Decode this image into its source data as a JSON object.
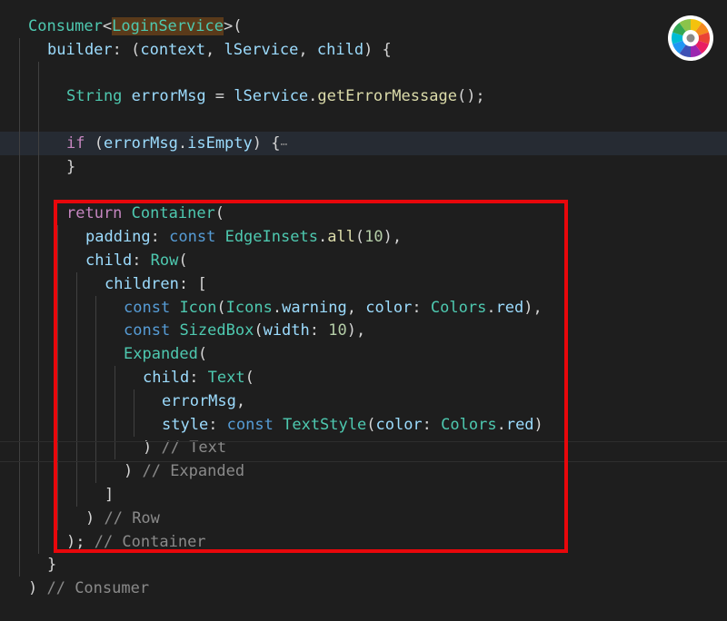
{
  "editor": {
    "language": "Dart",
    "highlight_color": "#e8070b",
    "lines": [
      {
        "indent": 0,
        "tokens": [
          {
            "t": "Consumer",
            "c": "type"
          },
          {
            "t": "<",
            "c": "punc"
          },
          {
            "t": "LoginService",
            "c": "type",
            "hl": true
          },
          {
            "t": ">(",
            "c": "punc"
          }
        ]
      },
      {
        "indent": 1,
        "tokens": [
          {
            "t": "builder",
            "c": "var"
          },
          {
            "t": ": (",
            "c": "punc"
          },
          {
            "t": "context",
            "c": "var"
          },
          {
            "t": ", ",
            "c": "punc"
          },
          {
            "t": "lService",
            "c": "var"
          },
          {
            "t": ", ",
            "c": "punc"
          },
          {
            "t": "child",
            "c": "var"
          },
          {
            "t": ") {",
            "c": "punc"
          }
        ]
      },
      {
        "indent": 2,
        "tokens": []
      },
      {
        "indent": 2,
        "tokens": [
          {
            "t": "String",
            "c": "type"
          },
          {
            "t": " ",
            "c": "punc"
          },
          {
            "t": "errorMsg",
            "c": "var"
          },
          {
            "t": " = ",
            "c": "punc"
          },
          {
            "t": "lService",
            "c": "var"
          },
          {
            "t": ".",
            "c": "punc"
          },
          {
            "t": "getErrorMessage",
            "c": "fn"
          },
          {
            "t": "();",
            "c": "punc"
          }
        ]
      },
      {
        "indent": 2,
        "tokens": []
      },
      {
        "indent": 2,
        "current": true,
        "tokens": [
          {
            "t": "if",
            "c": "kw"
          },
          {
            "t": " (",
            "c": "punc"
          },
          {
            "t": "errorMsg",
            "c": "var"
          },
          {
            "t": ".",
            "c": "punc"
          },
          {
            "t": "isEmpty",
            "c": "var"
          },
          {
            "t": ") {",
            "c": "punc"
          },
          {
            "t": "⋯",
            "c": "fold"
          }
        ]
      },
      {
        "indent": 2,
        "tokens": [
          {
            "t": "}",
            "c": "punc"
          }
        ]
      },
      {
        "indent": 2,
        "tokens": []
      },
      {
        "indent": 2,
        "tokens": [
          {
            "t": "return",
            "c": "kw"
          },
          {
            "t": " ",
            "c": "punc"
          },
          {
            "t": "Container",
            "c": "type"
          },
          {
            "t": "(",
            "c": "punc"
          }
        ]
      },
      {
        "indent": 3,
        "tokens": [
          {
            "t": "padding",
            "c": "var"
          },
          {
            "t": ": ",
            "c": "punc"
          },
          {
            "t": "const",
            "c": "kw2"
          },
          {
            "t": " ",
            "c": "punc"
          },
          {
            "t": "EdgeInsets",
            "c": "type"
          },
          {
            "t": ".",
            "c": "punc"
          },
          {
            "t": "all",
            "c": "fn"
          },
          {
            "t": "(",
            "c": "punc"
          },
          {
            "t": "10",
            "c": "num"
          },
          {
            "t": "),",
            "c": "punc"
          }
        ]
      },
      {
        "indent": 3,
        "tokens": [
          {
            "t": "child",
            "c": "var"
          },
          {
            "t": ": ",
            "c": "punc"
          },
          {
            "t": "Row",
            "c": "type"
          },
          {
            "t": "(",
            "c": "punc"
          }
        ]
      },
      {
        "indent": 4,
        "tokens": [
          {
            "t": "children",
            "c": "var"
          },
          {
            "t": ": [",
            "c": "punc"
          }
        ]
      },
      {
        "indent": 5,
        "tokens": [
          {
            "t": "const",
            "c": "kw2"
          },
          {
            "t": " ",
            "c": "punc"
          },
          {
            "t": "Icon",
            "c": "type"
          },
          {
            "t": "(",
            "c": "punc"
          },
          {
            "t": "Icons",
            "c": "type"
          },
          {
            "t": ".",
            "c": "punc"
          },
          {
            "t": "warning",
            "c": "var"
          },
          {
            "t": ", ",
            "c": "punc"
          },
          {
            "t": "color",
            "c": "var"
          },
          {
            "t": ": ",
            "c": "punc"
          },
          {
            "t": "Colors",
            "c": "type"
          },
          {
            "t": ".",
            "c": "punc"
          },
          {
            "t": "red",
            "c": "var"
          },
          {
            "t": "),",
            "c": "punc"
          }
        ]
      },
      {
        "indent": 5,
        "tokens": [
          {
            "t": "const",
            "c": "kw2"
          },
          {
            "t": " ",
            "c": "punc"
          },
          {
            "t": "SizedBox",
            "c": "type"
          },
          {
            "t": "(",
            "c": "punc"
          },
          {
            "t": "width",
            "c": "var"
          },
          {
            "t": ": ",
            "c": "punc"
          },
          {
            "t": "10",
            "c": "num"
          },
          {
            "t": "),",
            "c": "punc"
          }
        ]
      },
      {
        "indent": 5,
        "tokens": [
          {
            "t": "Expanded",
            "c": "type"
          },
          {
            "t": "(",
            "c": "punc"
          }
        ]
      },
      {
        "indent": 6,
        "tokens": [
          {
            "t": "child",
            "c": "var"
          },
          {
            "t": ": ",
            "c": "punc"
          },
          {
            "t": "Text",
            "c": "type"
          },
          {
            "t": "(",
            "c": "punc"
          }
        ]
      },
      {
        "indent": 7,
        "tokens": [
          {
            "t": "errorMsg",
            "c": "var"
          },
          {
            "t": ",",
            "c": "punc"
          }
        ]
      },
      {
        "indent": 7,
        "tokens": [
          {
            "t": "style",
            "c": "var"
          },
          {
            "t": ": ",
            "c": "punc"
          },
          {
            "t": "const",
            "c": "kw2"
          },
          {
            "t": " ",
            "c": "punc"
          },
          {
            "t": "TextStyle",
            "c": "type"
          },
          {
            "t": "(",
            "c": "punc"
          },
          {
            "t": "color",
            "c": "var"
          },
          {
            "t": ": ",
            "c": "punc"
          },
          {
            "t": "Colors",
            "c": "type"
          },
          {
            "t": ".",
            "c": "punc"
          },
          {
            "t": "red",
            "c": "var"
          },
          {
            "t": ")",
            "c": "punc"
          }
        ]
      },
      {
        "indent": 6,
        "tokens": [
          {
            "t": ") ",
            "c": "punc"
          },
          {
            "t": "// Text",
            "c": "cmt"
          }
        ]
      },
      {
        "indent": 5,
        "tokens": [
          {
            "t": ") ",
            "c": "punc"
          },
          {
            "t": "// Expanded",
            "c": "cmt"
          }
        ]
      },
      {
        "indent": 4,
        "tokens": [
          {
            "t": "]",
            "c": "punc"
          }
        ]
      },
      {
        "indent": 3,
        "tokens": [
          {
            "t": ") ",
            "c": "punc"
          },
          {
            "t": "// Row",
            "c": "cmt"
          }
        ]
      },
      {
        "indent": 2,
        "tokens": [
          {
            "t": "); ",
            "c": "punc"
          },
          {
            "t": "// Container",
            "c": "cmt"
          }
        ]
      },
      {
        "indent": 1,
        "tokens": [
          {
            "t": "}",
            "c": "punc"
          }
        ]
      },
      {
        "indent": 0,
        "tokens": [
          {
            "t": ") ",
            "c": "punc"
          },
          {
            "t": "// Consumer",
            "c": "cmt"
          }
        ]
      }
    ]
  },
  "icons": {
    "app_logo": "color-wheel-icon"
  }
}
